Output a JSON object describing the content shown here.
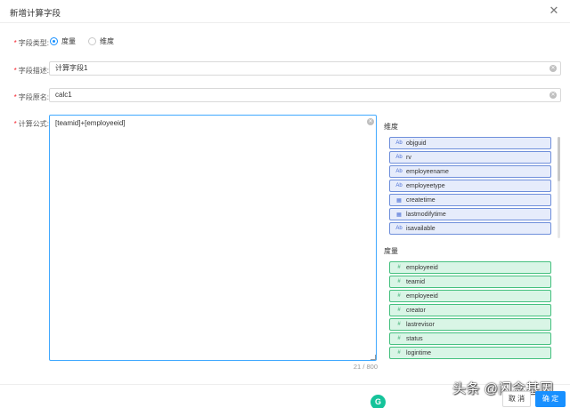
{
  "dialog": {
    "title": "新增计算字段",
    "close_icon": "close-icon"
  },
  "form": {
    "field_type": {
      "label": "字段类型:",
      "options": [
        {
          "label": "度量",
          "checked": true
        },
        {
          "label": "维度",
          "checked": false
        }
      ]
    },
    "description": {
      "label": "字段描述:",
      "value": "计算字段1"
    },
    "original_name": {
      "label": "字段原名:",
      "value": "calc1"
    },
    "formula": {
      "label": "计算公式:",
      "value": "[teamid]+[employeeid]",
      "counter": "21 / 800"
    }
  },
  "dimensions": {
    "title": "维度",
    "items": [
      {
        "label": "objguid",
        "icon": "abc-text-icon",
        "glyph": "Ab"
      },
      {
        "label": "rv",
        "icon": "abc-text-icon",
        "glyph": "Ab"
      },
      {
        "label": "employeename",
        "icon": "abc-text-icon",
        "glyph": "Ab"
      },
      {
        "label": "employeetype",
        "icon": "abc-text-icon",
        "glyph": "Ab"
      },
      {
        "label": "createtime",
        "icon": "calendar-icon",
        "glyph": "▦"
      },
      {
        "label": "lastmodifytime",
        "icon": "calendar-icon",
        "glyph": "▦"
      },
      {
        "label": "isavailable",
        "icon": "abc-text-icon",
        "glyph": "Ab"
      }
    ]
  },
  "measures": {
    "title": "度量",
    "items": [
      {
        "label": "employeeid",
        "icon": "number-icon",
        "glyph": "#"
      },
      {
        "label": "teamid",
        "icon": "number-icon",
        "glyph": "#"
      },
      {
        "label": "employeeid",
        "icon": "number-icon",
        "glyph": "#"
      },
      {
        "label": "creator",
        "icon": "number-icon",
        "glyph": "#"
      },
      {
        "label": "lastrevisor",
        "icon": "number-icon",
        "glyph": "#"
      },
      {
        "label": "status",
        "icon": "number-icon",
        "glyph": "#"
      },
      {
        "label": "logintime",
        "icon": "number-icon",
        "glyph": "#"
      }
    ]
  },
  "footer": {
    "cancel_label": "取 消",
    "ok_label": "确 定"
  },
  "overlay": {
    "grammarly_badge": "G",
    "watermark": "头条 @闪念基因"
  },
  "colors": {
    "accent": "#1890ff",
    "dimension_fill": "#e6ecfb",
    "measure_fill": "#d9f5e6"
  }
}
